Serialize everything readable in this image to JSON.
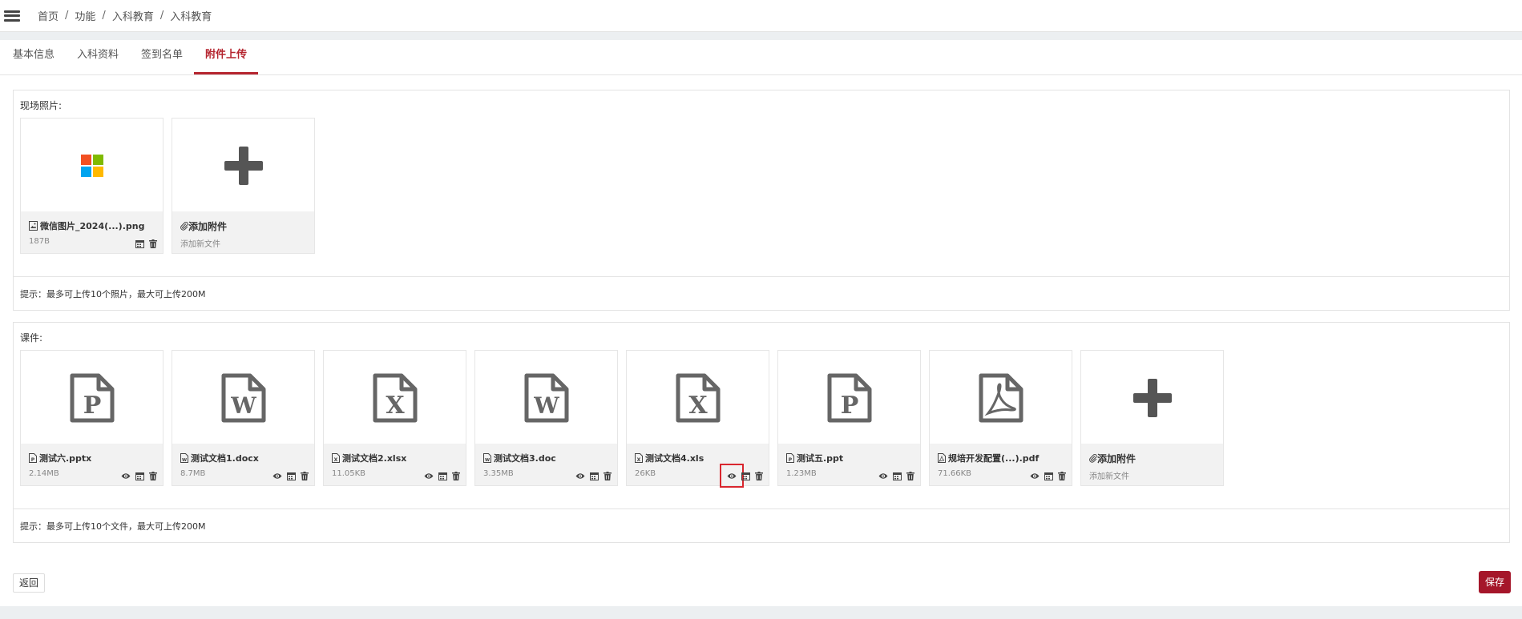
{
  "breadcrumb": [
    "首页",
    "功能",
    "入科教育",
    "入科教育"
  ],
  "breadcrumb_sep": "/",
  "tabs": [
    {
      "label": "基本信息",
      "active": false
    },
    {
      "label": "入科资料",
      "active": false
    },
    {
      "label": "签到名单",
      "active": false
    },
    {
      "label": "附件上传",
      "active": true
    }
  ],
  "photos": {
    "title": "现场照片:",
    "files": [
      {
        "name": "微信图片_2024(...).png",
        "size": "187B",
        "type": "image"
      }
    ],
    "add": {
      "title": "添加附件",
      "subtitle": "添加新文件"
    },
    "hint": "提示：最多可上传10个照片，最大可上传200M"
  },
  "courseware": {
    "title": "课件:",
    "files": [
      {
        "name": "测试六.pptx",
        "size": "2.14MB",
        "type": "ppt"
      },
      {
        "name": "测试文档1.docx",
        "size": "8.7MB",
        "type": "word"
      },
      {
        "name": "测试文档2.xlsx",
        "size": "11.05KB",
        "type": "excel"
      },
      {
        "name": "测试文档3.doc",
        "size": "3.35MB",
        "type": "word"
      },
      {
        "name": "测试文档4.xls",
        "size": "26KB",
        "type": "excel"
      },
      {
        "name": "测试五.ppt",
        "size": "1.23MB",
        "type": "ppt"
      },
      {
        "name": "规培开发配置(...).pdf",
        "size": "71.66KB",
        "type": "pdf"
      }
    ],
    "add": {
      "title": "添加附件",
      "subtitle": "添加新文件"
    },
    "hint": "提示：最多可上传10个文件，最大可上传200M"
  },
  "buttons": {
    "back": "返回",
    "save": "保存"
  },
  "colors": {
    "accent": "#b5252f",
    "save_bg": "#a5162a",
    "highlight": "#d9262e"
  }
}
